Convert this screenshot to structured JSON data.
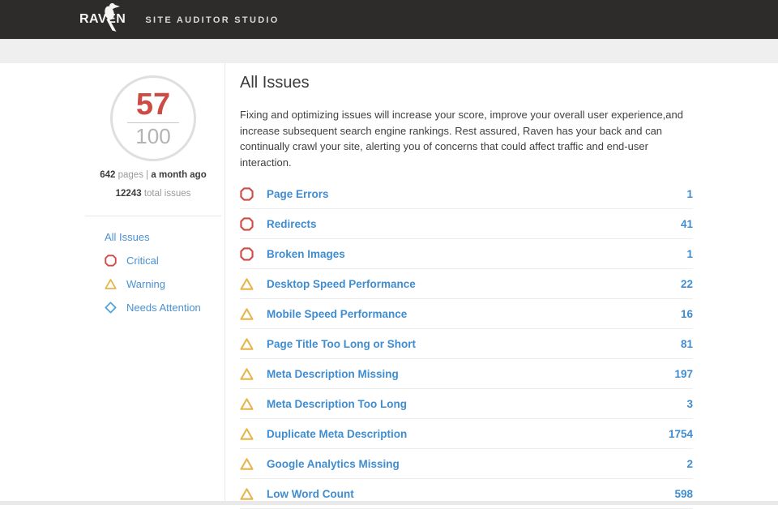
{
  "header": {
    "logo_text": "RAVEN",
    "app_title": "SITE AUDITOR STUDIO"
  },
  "sidebar": {
    "score": {
      "value": "57",
      "max": "100"
    },
    "meta": {
      "pages_count": "642",
      "pages_label": "pages",
      "separator": "|",
      "last_crawl": "a month ago",
      "total_issues": "12243",
      "total_issues_label": "total issues"
    },
    "nav": [
      {
        "label": "All Issues",
        "icon": "none"
      },
      {
        "label": "Critical",
        "icon": "critical"
      },
      {
        "label": "Warning",
        "icon": "warning"
      },
      {
        "label": "Needs Attention",
        "icon": "attention"
      }
    ]
  },
  "main": {
    "title": "All Issues",
    "description": "Fixing and optimizing issues will increase your score, improve your overall user experience,and increase subsequent search engine rankings. Rest assured, Raven has your back and can continually crawl your site, alerting you of concerns that could affect traffic and end-user interaction.",
    "issues": [
      {
        "label": "Page Errors",
        "count": "1",
        "severity": "critical"
      },
      {
        "label": "Redirects",
        "count": "41",
        "severity": "critical"
      },
      {
        "label": "Broken Images",
        "count": "1",
        "severity": "critical"
      },
      {
        "label": "Desktop Speed Performance",
        "count": "22",
        "severity": "warning"
      },
      {
        "label": "Mobile Speed Performance",
        "count": "16",
        "severity": "warning"
      },
      {
        "label": "Page Title Too Long or Short",
        "count": "81",
        "severity": "warning"
      },
      {
        "label": "Meta Description Missing",
        "count": "197",
        "severity": "warning"
      },
      {
        "label": "Meta Description Too Long",
        "count": "3",
        "severity": "warning"
      },
      {
        "label": "Duplicate Meta Description",
        "count": "1754",
        "severity": "warning"
      },
      {
        "label": "Google Analytics Missing",
        "count": "2",
        "severity": "warning"
      },
      {
        "label": "Low Word Count",
        "count": "598",
        "severity": "warning"
      }
    ]
  },
  "colors": {
    "critical": "#cf4b45",
    "warning": "#e7b44a",
    "attention": "#47a0da",
    "link_blue": "#3f8dd1",
    "score_red": "#cc4b44",
    "header_bg": "#2d2c2b"
  }
}
